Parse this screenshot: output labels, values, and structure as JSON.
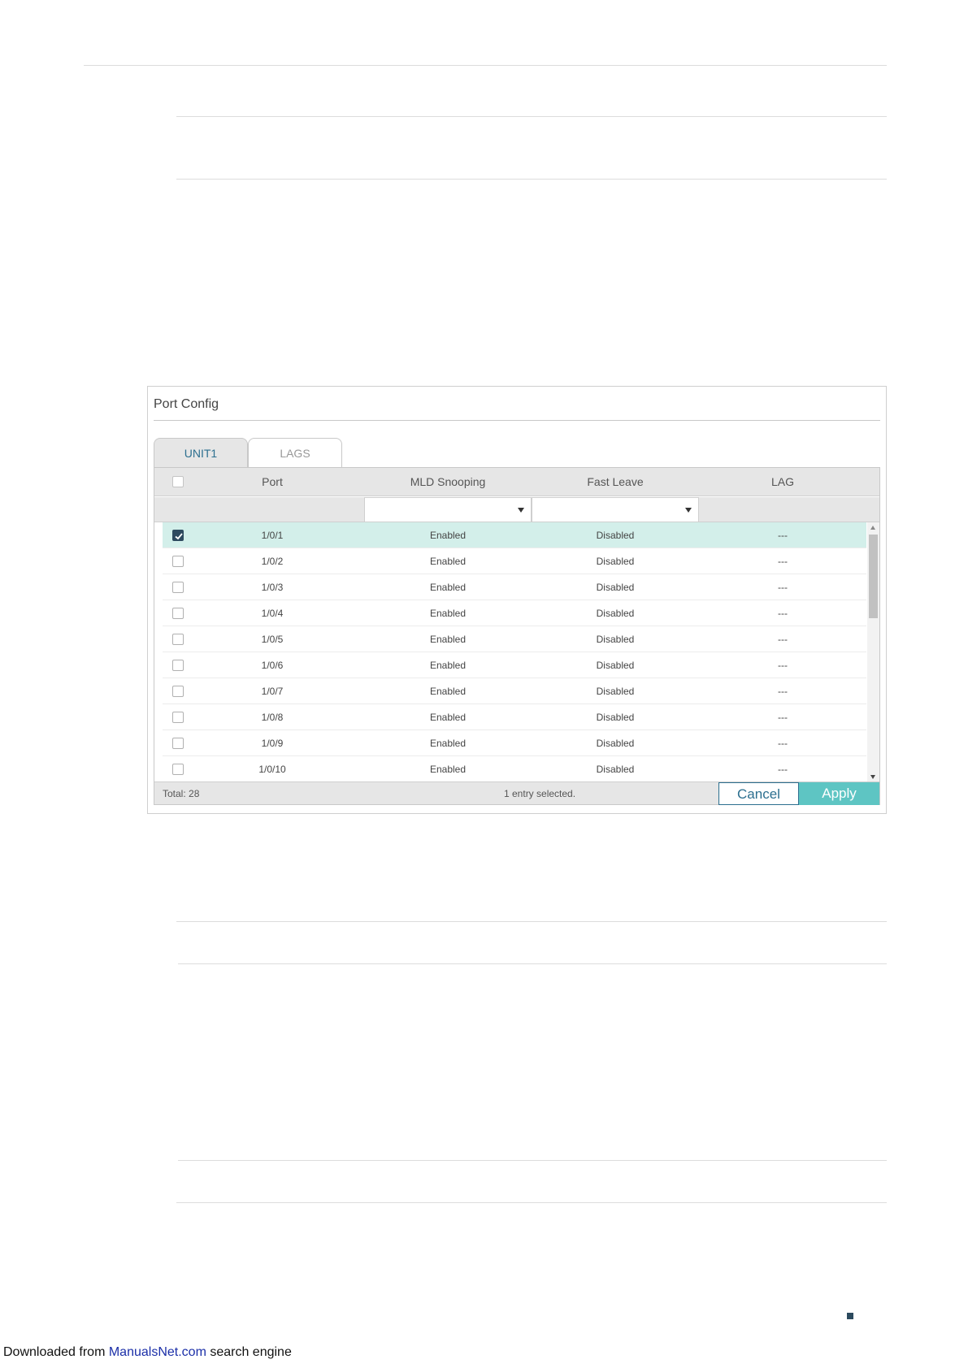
{
  "panel": {
    "title": "Port Config",
    "tabs": [
      {
        "label": "UNIT1",
        "active": true
      },
      {
        "label": "LAGS",
        "active": false
      }
    ],
    "columns": {
      "port": "Port",
      "mld_snooping": "MLD Snooping",
      "fast_leave": "Fast Leave",
      "lag": "LAG"
    },
    "rows": [
      {
        "port": "1/0/1",
        "mld": "Enabled",
        "fast_leave": "Disabled",
        "lag": "---",
        "checked": true
      },
      {
        "port": "1/0/2",
        "mld": "Enabled",
        "fast_leave": "Disabled",
        "lag": "---",
        "checked": false
      },
      {
        "port": "1/0/3",
        "mld": "Enabled",
        "fast_leave": "Disabled",
        "lag": "---",
        "checked": false
      },
      {
        "port": "1/0/4",
        "mld": "Enabled",
        "fast_leave": "Disabled",
        "lag": "---",
        "checked": false
      },
      {
        "port": "1/0/5",
        "mld": "Enabled",
        "fast_leave": "Disabled",
        "lag": "---",
        "checked": false
      },
      {
        "port": "1/0/6",
        "mld": "Enabled",
        "fast_leave": "Disabled",
        "lag": "---",
        "checked": false
      },
      {
        "port": "1/0/7",
        "mld": "Enabled",
        "fast_leave": "Disabled",
        "lag": "---",
        "checked": false
      },
      {
        "port": "1/0/8",
        "mld": "Enabled",
        "fast_leave": "Disabled",
        "lag": "---",
        "checked": false
      },
      {
        "port": "1/0/9",
        "mld": "Enabled",
        "fast_leave": "Disabled",
        "lag": "---",
        "checked": false
      },
      {
        "port": "1/0/10",
        "mld": "Enabled",
        "fast_leave": "Disabled",
        "lag": "---",
        "checked": false
      }
    ],
    "footer": {
      "total": "Total: 28",
      "selected": "1 entry selected.",
      "cancel_label": "Cancel",
      "apply_label": "Apply"
    }
  },
  "colors": {
    "selected_row": "#d3efea",
    "apply_button": "#5ec5c3",
    "accent": "#2c6f8f"
  },
  "icons": {
    "checkbox_checked": "check-icon",
    "dropdown": "chevron-down-icon"
  },
  "download_note": {
    "prefix": "Downloaded from ",
    "link": "ManualsNet.com",
    "suffix": " search engine"
  }
}
